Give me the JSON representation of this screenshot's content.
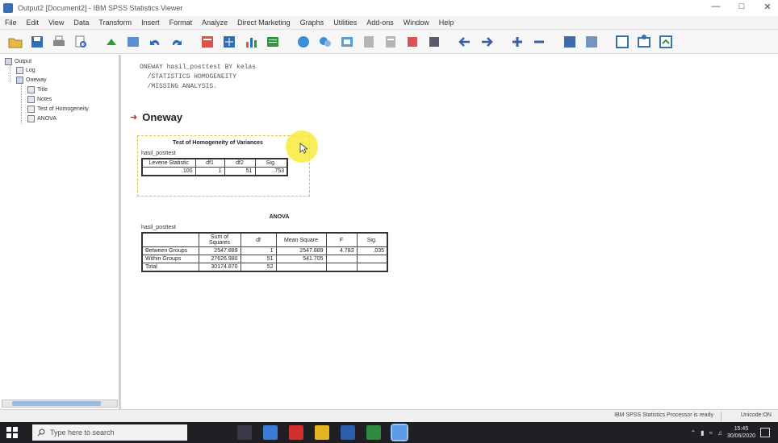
{
  "window": {
    "title": "Output2 [Document2] - IBM SPSS Statistics Viewer"
  },
  "menu": [
    "File",
    "Edit",
    "View",
    "Data",
    "Transform",
    "Insert",
    "Format",
    "Analyze",
    "Direct Marketing",
    "Graphs",
    "Utilities",
    "Add-ons",
    "Window",
    "Help"
  ],
  "outline": {
    "root": "Output",
    "log": "Log",
    "oneway": "Oneway",
    "title": "Title",
    "notes": "Notes",
    "homogeneity": "Test of Homogeneity",
    "anova": "ANOVA"
  },
  "syntax": {
    "line1": "ONEWAY hasil_posttest BY kelas",
    "line2": "  /STATISTICS HOMOGENEITY",
    "line3": "  /MISSING ANALYSIS."
  },
  "oneway_heading": "Oneway",
  "homogeneity": {
    "title": "Test of Homogeneity of Variances",
    "variable": "hasil_posttest",
    "headers": [
      "Levene Statistic",
      "df1",
      "df2",
      "Sig."
    ],
    "row": [
      ".100",
      "1",
      "51",
      ".753"
    ]
  },
  "anova": {
    "title": "ANOVA",
    "variable": "hasil_posttest",
    "headers": [
      "",
      "Sum of Squares",
      "df",
      "Mean Square",
      "F",
      "Sig."
    ],
    "rows": [
      [
        "Between Groups",
        "2547.889",
        "1",
        "2547.889",
        "4.783",
        ".035"
      ],
      [
        "Within Groups",
        "27626.980",
        "51",
        "541.705",
        "",
        ""
      ],
      [
        "Total",
        "30174.870",
        "52",
        "",
        "",
        ""
      ]
    ]
  },
  "status": {
    "processor": "IBM SPSS Statistics Processor is ready",
    "encoding": "Unicode:ON"
  },
  "taskbar": {
    "search_placeholder": "Type here to search",
    "time": "15:45",
    "date": "30/06/2020"
  }
}
